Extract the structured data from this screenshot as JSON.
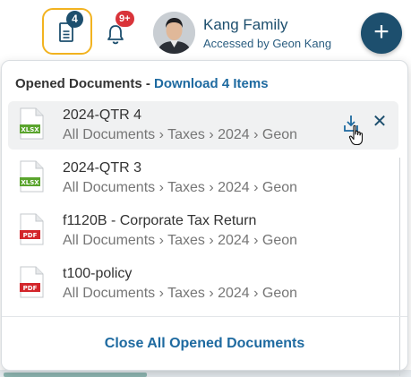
{
  "topbar": {
    "documents_count": "4",
    "notifications_count": "9+",
    "account_name": "Kang Family",
    "accessed_by": "Accessed by Geon Kang",
    "add_label": "+",
    "accent_color": "#f2b320",
    "brand_color": "#1d4f6e",
    "notification_color": "#d9343a"
  },
  "panel": {
    "title": "Opened Documents - ",
    "download_all_label": "Download 4 Items",
    "close_all_label": "Close All Opened Documents",
    "link_color": "#1e6aa0",
    "items": [
      {
        "name": "2024-QTR 4",
        "path": "All Documents › Taxes  › 2024 › Geon",
        "type": "XLSX",
        "icon": "xlsx-file-icon",
        "hovered": true
      },
      {
        "name": "2024-QTR 3",
        "path": "All Documents › Taxes  › 2024 › Geon",
        "type": "XLSX",
        "icon": "xlsx-file-icon",
        "hovered": false
      },
      {
        "name": "f1120B - Corporate Tax Return",
        "path": "All Documents › Taxes  › 2024 › Geon",
        "type": "PDF",
        "icon": "pdf-file-icon",
        "hovered": false
      },
      {
        "name": "t100-policy",
        "path": "All Documents › Taxes  › 2024 › Geon",
        "type": "PDF",
        "icon": "pdf-file-icon",
        "hovered": false
      }
    ]
  }
}
